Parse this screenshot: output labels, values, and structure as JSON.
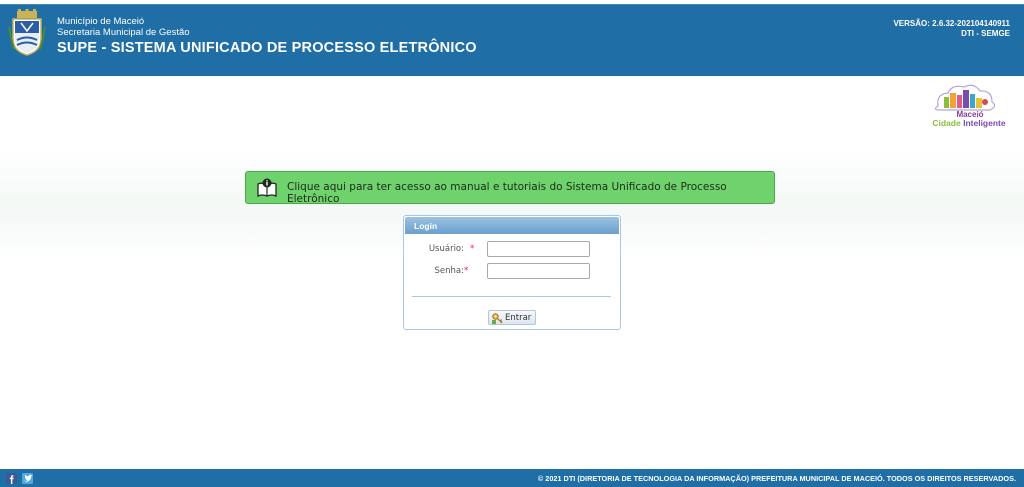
{
  "header": {
    "org_line1": "Município de Maceió",
    "org_line2": "Secretaria Municipal de Gestão",
    "system_title": "SUPE - SISTEMA UNIFICADO DE PROCESSO ELETRÔNICO",
    "version": "VERSÃO: 2.6.32-202104140911",
    "department": "DTI - SEMGE"
  },
  "city_logo": {
    "line1": "Maceió",
    "line2_part1": "Cidade",
    "line2_part2": "Inteligente"
  },
  "manual_banner": {
    "text": "Clique aqui para ter acesso ao manual e tutoriais do Sistema Unificado de Processo Eletrônico",
    "icon": "book-info-icon"
  },
  "login": {
    "title": "Login",
    "username_label": "Usuário:",
    "password_label": "Senha:",
    "required_marker": "*",
    "username_value": "",
    "password_value": "",
    "submit_label": "Entrar",
    "submit_icon": "key-icon"
  },
  "footer": {
    "copyright": "© 2021 DTI (DIRETORIA DE TECNOLOGIA DA INFORMAÇÃO) PREFEITURA MUNICIPAL DE MACEIÓ. TODOS OS DIREITOS RESERVADOS.",
    "social": [
      "facebook-icon",
      "twitter-icon"
    ]
  },
  "colors": {
    "header_bg": "#1f6ea6",
    "banner_bg": "#6fd26d",
    "login_header": "#7aa9d4",
    "required": "#dd2233"
  }
}
